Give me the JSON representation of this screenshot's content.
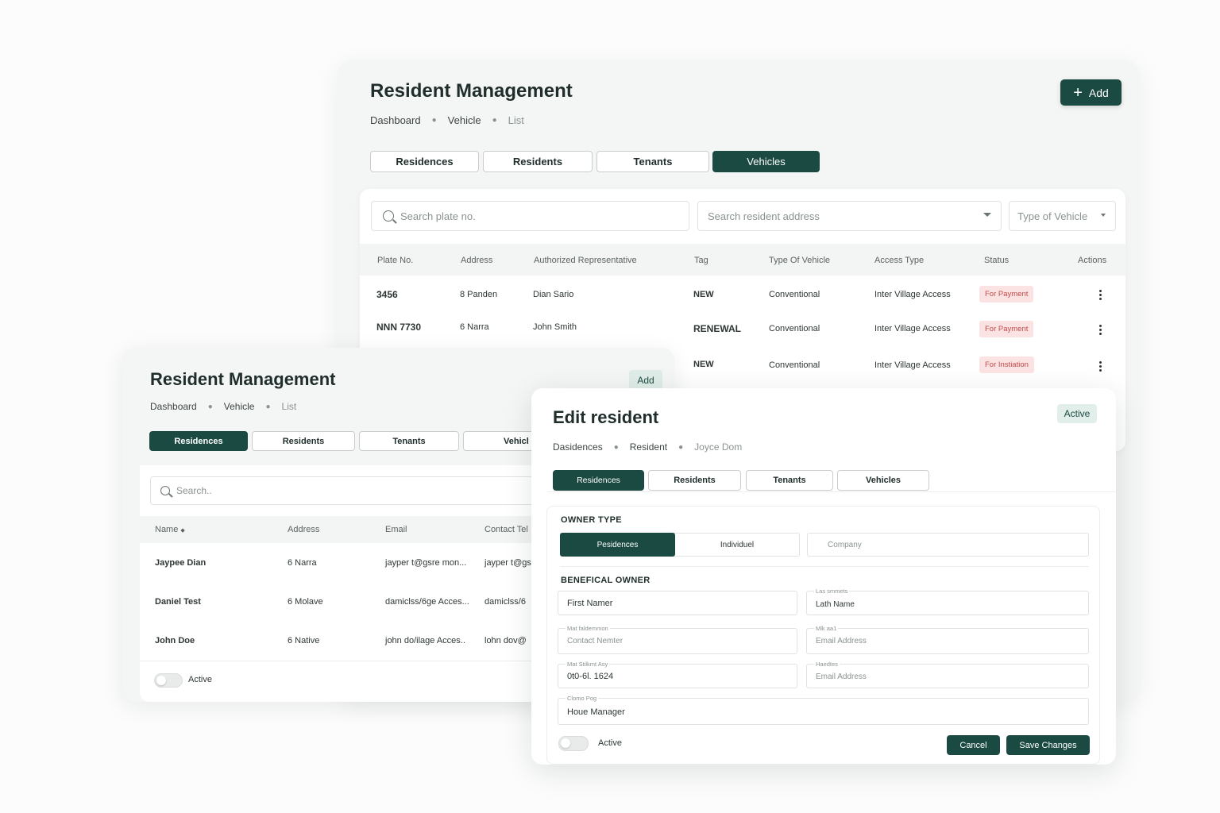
{
  "colors": {
    "brand": "#1a4a42",
    "badge_red_bg": "#fbe3e3",
    "badge_red_text": "#c24a4a",
    "soft_green": "#dfece7"
  },
  "main": {
    "title": "Resident Management",
    "breadcrumb": [
      "Dashboard",
      "Vehicle",
      "List"
    ],
    "add_label": "Add",
    "tabs": [
      "Residences",
      "Residents",
      "Tenants",
      "Vehicles"
    ],
    "search_plate_placeholder": "Search plate no.",
    "search_address_placeholder": "Search resident address",
    "type_filter": "Type of Vehicle",
    "columns": [
      "Plate No.",
      "Address",
      "Authorized Representative",
      "Tag",
      "Type Of Vehicle",
      "Access Type",
      "Status",
      "Actions"
    ],
    "rows": [
      {
        "plate": "3456",
        "address": "8 Panden",
        "rep": "Dian Sario",
        "tag": "NEW",
        "type": "Conventional",
        "access": "Inter Village Access",
        "status": "For Payment"
      },
      {
        "plate": "NNN 7730",
        "address": "6 Narra",
        "rep": "John Smith",
        "tag": "RENEWAL",
        "type": "Conventional",
        "access": "Inter Village Access",
        "status": "For Payment"
      },
      {
        "plate": "",
        "address": "",
        "rep": "",
        "tag": "NEW",
        "type": "Conventional",
        "access": "Inter Village Access",
        "status": "For Instiation"
      }
    ]
  },
  "residents": {
    "title": "Resident Management",
    "breadcrumb": [
      "Dashboard",
      "Vehicle",
      "List"
    ],
    "add_label": "Add",
    "tabs": [
      "Residences",
      "Residents",
      "Tenants",
      "Vehicl"
    ],
    "search_placeholder": "Search..",
    "columns": [
      "Name",
      "Address",
      "Email",
      "Contact Tel"
    ],
    "rows": [
      {
        "name": "Jaypee Dian",
        "address": "6 Narra",
        "email": "jayper t@gsre mon...",
        "contact": "jayper t@gs"
      },
      {
        "name": "Daniel Test",
        "address": "6 Molave",
        "email": "damiclss/6ge Acces...",
        "contact": "damiclss/6"
      },
      {
        "name": "John Doe",
        "address": "6 Native",
        "email": "john do/ilage Acces..",
        "contact": "lohn dov@"
      }
    ],
    "toggle_label": "Active"
  },
  "edit": {
    "title": "Edit resident",
    "status": "Active",
    "breadcrumb": [
      "Dasidences",
      "Resident",
      "Joyce Dom"
    ],
    "tabs": [
      "Residences",
      "Residents",
      "Tenants",
      "Vehicles"
    ],
    "owner_type_label": "OWNER TYPE",
    "owner_types": [
      "Pesidences",
      "Individuel",
      "Company"
    ],
    "beneficial_owner_label": "BENEFICAL OWNER",
    "fields": {
      "first_name": "First Namer",
      "last_name_mini": "Las smmets",
      "last_name": "Lath Name",
      "contact_mini": "Mat faldemmon",
      "contact": "Contact Nemter",
      "email1_mini": "Mlk aa1",
      "email1": "Email Address",
      "phone_mini": "Mat Stilkmt Asy",
      "phone": "0t0-6l. 1624",
      "email2_mini": "Haedtes",
      "email2": "Email Address",
      "role_mini": "Clomo Pog",
      "role": "Houe Manager"
    },
    "toggle_label": "Active",
    "cancel_label": "Cancel",
    "save_label": "Save Changes"
  }
}
